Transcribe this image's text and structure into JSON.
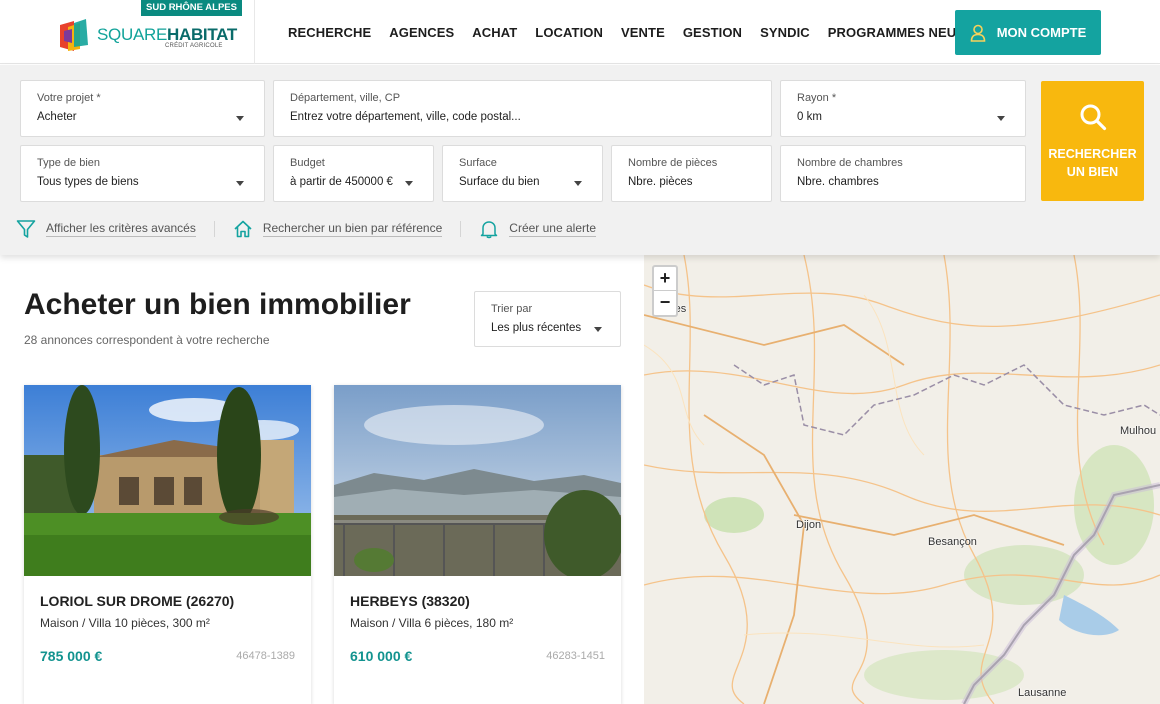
{
  "header": {
    "badge": "SUD RHÔNE ALPES",
    "logo_part1": "SQUARE",
    "logo_part2": "HABITAT",
    "logo_sub": "CRÉDIT AGRICOLE",
    "nav": [
      "RECHERCHE",
      "AGENCES",
      "ACHAT",
      "LOCATION",
      "VENTE",
      "GESTION",
      "SYNDIC",
      "PROGRAMMES NEUFS"
    ],
    "account_label": "MON COMPTE"
  },
  "search": {
    "projet": {
      "label": "Votre projet *",
      "value": "Acheter"
    },
    "location": {
      "label": "Département, ville, CP",
      "placeholder": "Entrez votre département, ville, code postal..."
    },
    "rayon": {
      "label": "Rayon *",
      "value": "0 km"
    },
    "type_bien": {
      "label": "Type de bien",
      "value": "Tous types de biens"
    },
    "budget": {
      "label": "Budget",
      "value": "à partir de 450000 €"
    },
    "surface": {
      "label": "Surface",
      "value": "Surface du bien"
    },
    "pieces": {
      "label": "Nombre de pièces",
      "value": "Nbre. pièces"
    },
    "chambres": {
      "label": "Nombre de chambres",
      "value": "Nbre. chambres"
    },
    "button_line1": "RECHERCHER",
    "button_line2": "UN BIEN",
    "links": {
      "advanced": "Afficher les critères avancés",
      "reference": "Rechercher un bien par référence",
      "alert": "Créer une alerte"
    }
  },
  "results": {
    "title_bold": "Acheter",
    "title_rest": " un bien immobilier",
    "count": "28 annonces correspondent à votre recherche",
    "sort": {
      "label": "Trier par",
      "value": "Les plus récentes"
    },
    "cards": [
      {
        "city": "LORIOL SUR DROME (26270)",
        "type": "Maison / Villa 10 pièces, 300 m²",
        "price": "785 000 €",
        "ref": "46478-1389"
      },
      {
        "city": "HERBEYS (38320)",
        "type": "Maison / Villa 6 pièces, 180 m²",
        "price": "610 000 €",
        "ref": "46283-1451"
      }
    ]
  },
  "map": {
    "zoom_in": "+",
    "zoom_out": "−",
    "places": {
      "troyes": "Troyes",
      "mulhouse": "Mulhou",
      "dijon": "Dijon",
      "besancon": "Besançon",
      "lausanne": "Lausanne"
    }
  },
  "colors": {
    "teal": "#14a3a0",
    "yellow": "#f8b80e",
    "price": "#12938f"
  }
}
